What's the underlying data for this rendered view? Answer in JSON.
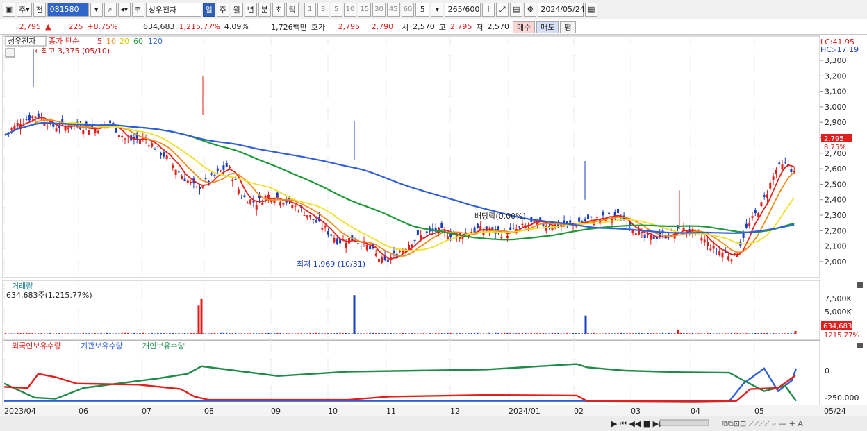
{
  "toolbar": {
    "market": "주",
    "prev_label": "전",
    "code": "081580",
    "market_tag": "코",
    "stock_name": "성우전자",
    "periods": [
      "일",
      "주",
      "월",
      "년",
      "분",
      "초",
      "틱"
    ],
    "active_period": "일",
    "intervals": [
      "1",
      "3",
      "5",
      "10",
      "15",
      "30",
      "45",
      "60"
    ],
    "interval_value": "5",
    "count": "265",
    "count_max": "/600",
    "date": "2024/05/24"
  },
  "quote": {
    "price": "2,795",
    "change_arrow": "▲",
    "change": "225",
    "change_pct": "+8.75%",
    "volume": "634,683",
    "volume_pct": "1,215.77%",
    "turnover": "4.09%",
    "amount": "1,726백만",
    "bid_label": "호가",
    "ask_price": "2,795",
    "bid_price": "2,790",
    "open_label": "시",
    "open": "2,570",
    "high_label": "고",
    "high": "2,795",
    "low_label": "저",
    "low": "2,570",
    "buy_label": "매수",
    "sell_label": "매도",
    "eval_label": "평"
  },
  "price_panel": {
    "legend_name": "성우전자",
    "legend_ma_label": "종가 단순",
    "ma_periods": [
      "5",
      "10",
      "20",
      "60",
      "120"
    ],
    "ma_colors": [
      "#e8201c",
      "#f08c1c",
      "#f0e020",
      "#1f9a3a",
      "#2f5fd8"
    ],
    "high_annotation": "←최고 3,375 (05/10)",
    "low_annotation": "최저 1,969 (10/31)",
    "dividend_annotation": "배당락(0.00%)",
    "lc_label": "LC:41.95",
    "hc_label": "HC:-17.19",
    "current_price_tag": "2,795",
    "current_pct_tag": "8.75%",
    "y_ticks": [
      "3,300",
      "3,200",
      "3,100",
      "3,000",
      "2,900",
      "2,800",
      "2,700",
      "2,600",
      "2,500",
      "2,400",
      "2,300",
      "2,200",
      "2,100",
      "2,000"
    ]
  },
  "volume_panel": {
    "title": "거래량",
    "value": "634,683주(1,215.77%)",
    "y_ticks": [
      "7,500K",
      "5,000K"
    ],
    "current_tag": "634,683",
    "current_pct": "1215.77%"
  },
  "holdings_panel": {
    "series": [
      "외국인보유수량",
      "기관보유수량",
      "개인보유수량"
    ],
    "series_colors": [
      "#e0201c",
      "#2f5fd8",
      "#1f8a4a"
    ],
    "y_ticks": [
      "0",
      "-250,000"
    ]
  },
  "x_axis": [
    "2023/04",
    "06",
    "07",
    "08",
    "09",
    "10",
    "11",
    "12",
    "2024/01",
    "02",
    "03",
    "04",
    "05",
    "05/24"
  ],
  "colors": {
    "up": "#e0201c",
    "down": "#1a3fc0",
    "accent": "#2f5fb3"
  }
}
